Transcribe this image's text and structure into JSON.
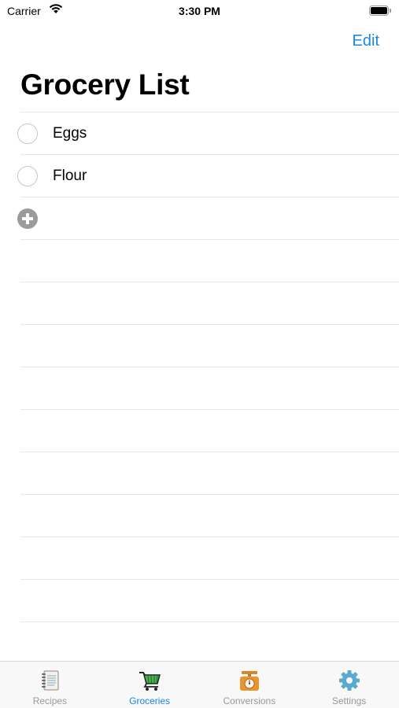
{
  "status_bar": {
    "carrier": "Carrier",
    "time": "3:30 PM"
  },
  "nav": {
    "edit_label": "Edit",
    "title": "Grocery List"
  },
  "items": [
    {
      "label": "Eggs",
      "checked": false
    },
    {
      "label": "Flour",
      "checked": false
    }
  ],
  "tabs": [
    {
      "label": "Recipes",
      "icon": "recipes-notebook-icon",
      "active": false
    },
    {
      "label": "Groceries",
      "icon": "shopping-cart-icon",
      "active": true
    },
    {
      "label": "Conversions",
      "icon": "kitchen-scale-icon",
      "active": false
    },
    {
      "label": "Settings",
      "icon": "gear-icon",
      "active": false
    }
  ],
  "colors": {
    "accent": "#1a86e8",
    "tab_inactive": "#999999",
    "separator": "#e6e6e6"
  }
}
